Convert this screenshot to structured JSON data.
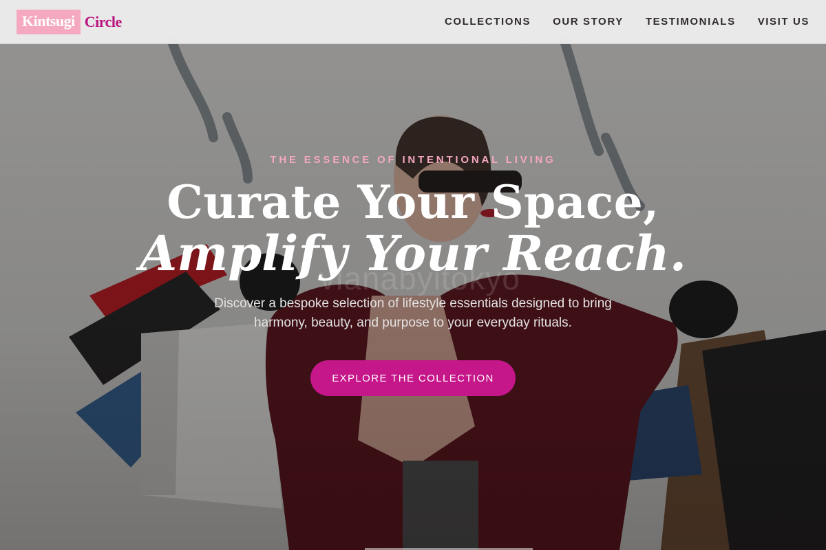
{
  "header": {
    "logo_part1": "Kintsugi",
    "logo_part2": "Circle",
    "nav": [
      "COLLECTIONS",
      "OUR STORY",
      "TESTIMONIALS",
      "VISIT US"
    ]
  },
  "hero": {
    "eyebrow": "THE ESSENCE OF INTENTIONAL LIVING",
    "headline_line1": "Curate Your Space,",
    "headline_line2": "Amplify Your Reach.",
    "subheadline": "Discover a bespoke selection of lifestyle essentials designed to bring harmony, beauty, and purpose to your everyday rituals.",
    "cta_label": "EXPLORE THE COLLECTION",
    "watermark": "vianabyitokyo",
    "background_image": "woman-with-shopping-bags-photo"
  },
  "colors": {
    "brand": "#c5168a",
    "logo_block": "#f5a9c0",
    "eyebrow": "#f4a8c0",
    "header_bg": "#ececec",
    "nav_text": "#2f2a2c"
  }
}
